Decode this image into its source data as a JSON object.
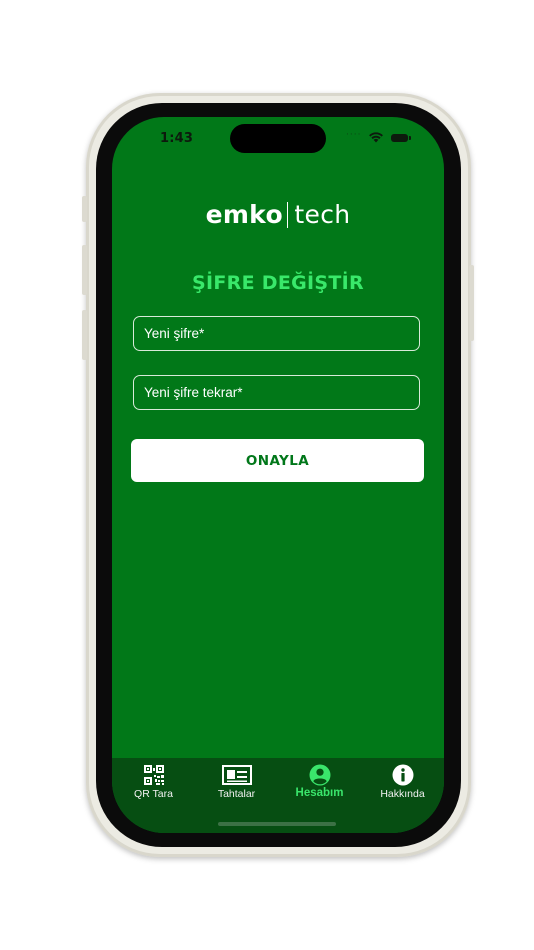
{
  "status_bar": {
    "time": "1:43"
  },
  "app": {
    "brand_left": "emko",
    "brand_right": "tech",
    "page_title": "ŞİFRE DEĞİŞTİR"
  },
  "form": {
    "new_password_placeholder": "Yeni şifre*",
    "repeat_password_placeholder": "Yeni şifre tekrar*",
    "confirm_label": "ONAYLA"
  },
  "tabbar": {
    "items": [
      {
        "label": "QR Tara",
        "icon": "qr-code-icon"
      },
      {
        "label": "Tahtalar",
        "icon": "board-icon"
      },
      {
        "label": "Hesabım",
        "icon": "account-icon",
        "active": true
      },
      {
        "label": "Hakkında",
        "icon": "info-icon"
      }
    ]
  },
  "colors": {
    "screen_bg": "#017818",
    "title_accent": "#39e86a",
    "tabbar_bg": "#064e12",
    "button_text": "#01771a"
  }
}
